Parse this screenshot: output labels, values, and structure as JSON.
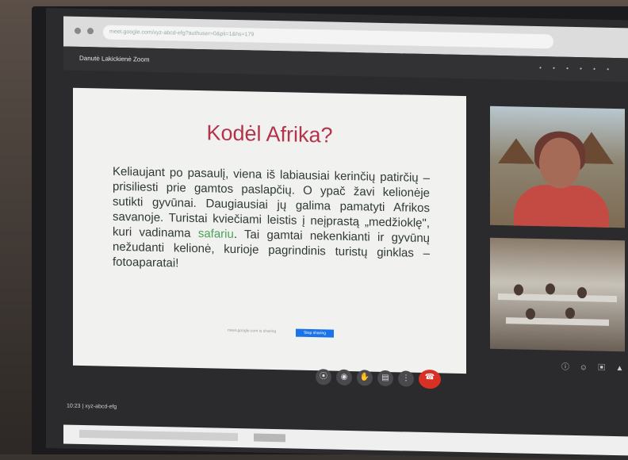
{
  "browser": {
    "url": "meet.google.com/xyz-abcd-efg?authuser=0&pli=1&hs=179",
    "meeting_title": "Danutė Lakickienė Zoom",
    "header_icons": "• • • • • •"
  },
  "slide": {
    "title": "Kodėl Afrika?",
    "body_before": "Keliaujant po pasaulį, viena iš labiausiai kerinčių patirčių – prisiliesti prie gamtos paslapčių. O ypač žavi kelionėje sutikti gyvūnai. Daugiausiai jų galima pamatyti Afrikos savanoje. Turistai kviečiami leistis į neįprastą „medžioklę\", kuri vadinama ",
    "highlight": "safariu",
    "body_after": ". Tai gamtai nekenkianti ir gyvūnų nežudanti kelionė, kurioje pagrindinis turistų ginklas – fotoaparatai!",
    "share_text": "meet.google.com is sharing",
    "share_button": "Stop sharing"
  },
  "controls": {
    "mic": "⦿",
    "cam": "◉",
    "hand": "✋",
    "captions": "▤",
    "more": "⋮",
    "end": "☎"
  },
  "side_icons": "ⓘ ☺ ▣ ▲",
  "meeting_code": "10:23 | xyz-abcd-efg",
  "colors": {
    "title_red": "#b3344a",
    "highlight_green": "#4aa35a",
    "end_call_red": "#d93025"
  }
}
